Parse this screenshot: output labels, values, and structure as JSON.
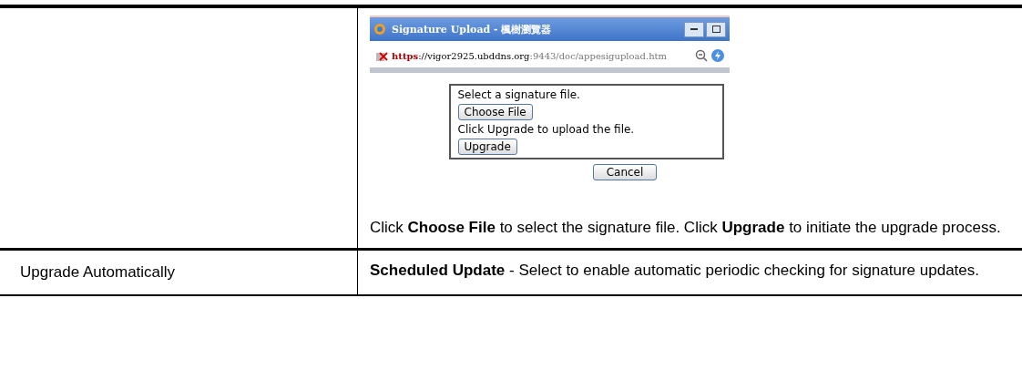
{
  "rows": [
    {
      "label": "",
      "screenshot": {
        "window_title": "Signature Upload - 楓樹瀏覽器",
        "url_scheme": "https",
        "url_host": "://vigor2925.ubddns.org",
        "url_path": ":9443/doc/appesigupload.htm",
        "dialog": {
          "prompt1": "Select a signature file.",
          "button1": "Choose File",
          "prompt2": "Click Upgrade to upload the file.",
          "button2": "Upgrade",
          "cancel": "Cancel"
        }
      },
      "description": "Click **Choose File** to select the signature file. Click **Upgrade** to initiate the upgrade process."
    },
    {
      "label": "Upgrade Automatically",
      "description": "**Scheduled Update** - Select to enable automatic periodic checking for signature updates."
    }
  ]
}
